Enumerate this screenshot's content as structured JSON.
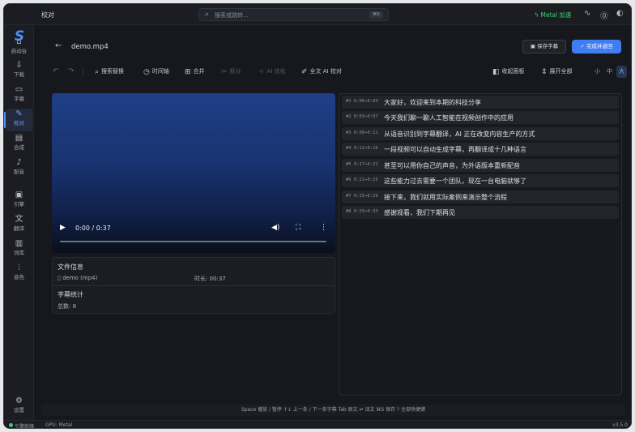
{
  "app": {
    "window_title": "校对",
    "logo_letter": "S"
  },
  "search": {
    "placeholder": "搜索或跳转...",
    "shortcut": "⌘K",
    "icon": "search-icon"
  },
  "titlebar": {
    "metal_label": "Metal 加速",
    "icons": [
      "activity-icon",
      "help-icon",
      "theme-icon"
    ]
  },
  "sidebar": {
    "items": [
      {
        "label": "启动台",
        "icon": "home-icon"
      },
      {
        "label": "下载",
        "icon": "download-icon"
      },
      {
        "label": "字幕",
        "icon": "subtitle-icon"
      },
      {
        "label": "校对",
        "icon": "pen-icon",
        "active": true
      },
      {
        "label": "合成",
        "icon": "film-icon"
      },
      {
        "label": "配音",
        "icon": "mic-icon"
      },
      {
        "label": "引擎",
        "icon": "cpu-icon"
      },
      {
        "label": "翻译",
        "icon": "translate-icon"
      },
      {
        "label": "词库",
        "icon": "book-icon"
      },
      {
        "label": "音色",
        "icon": "waveform-icon"
      }
    ],
    "settings_label": "设置"
  },
  "header": {
    "file_name": "demo.mp4",
    "save_label": "保存字幕",
    "done_label": "完成并返回"
  },
  "toolbar": {
    "search_replace": "搜索替换",
    "timeline": "时间轴",
    "merge": "合并",
    "split": "拆分",
    "ai_optimize": "AI 优化",
    "full_ai_proof": "全文 AI 校对",
    "collapse_panel": "收起面板",
    "expand_all": "展开全部",
    "sizes": [
      "小",
      "中",
      "大"
    ],
    "active_size": "大"
  },
  "video": {
    "time": "0:00 / 0:37"
  },
  "file_info": {
    "title": "文件信息",
    "file": "demo (mp4)",
    "duration": "时长: 00:37"
  },
  "stats": {
    "title": "字幕统计",
    "total": "总数: 8"
  },
  "subtitles": [
    {
      "time": "#1 0:00→0:03",
      "text": "大家好，欢迎来到本期的科技分享"
    },
    {
      "time": "#2 0:03→0:07",
      "text": "今天我们聊一聊人工智能在视频创作中的应用"
    },
    {
      "time": "#3 0:08→0:12",
      "text": "从语音识别到字幕翻译，AI 正在改变内容生产的方式"
    },
    {
      "time": "#4 0:12→0:16",
      "text": "一段视频可以自动生成字幕，再翻译成十几种语言"
    },
    {
      "time": "#5 0:17→0:21",
      "text": "甚至可以用你自己的声音，为外语版本重新配音"
    },
    {
      "time": "#6 0:21→0:25",
      "text": "这些能力过去需要一个团队，现在一台电脑就够了"
    },
    {
      "time": "#7 0:25→0:29",
      "text": "接下来，我们就用实际案例来演示整个流程"
    },
    {
      "time": "#8 0:29→0:33",
      "text": "感谢观看，我们下期再见"
    }
  ],
  "shortcuts_hint": "Space 播放 / 暂停   ↑↓ 上一条 / 下一条字幕   Tab 原文 ⇌ 译文   ⌘S 保存   ? 全部快捷键",
  "statusbar": {
    "engine": "引擎就绪",
    "gpu": "GPU: Metal",
    "version": "v3.5.0"
  }
}
